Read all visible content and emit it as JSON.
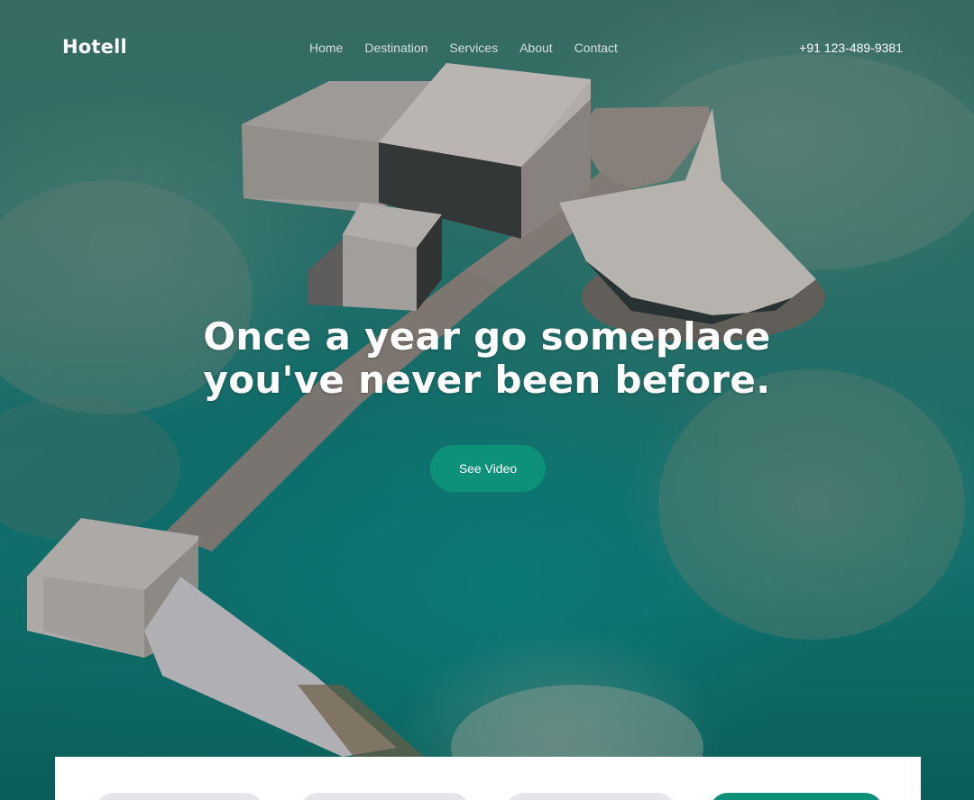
{
  "brand": {
    "name": "Hotell"
  },
  "nav": {
    "items": [
      {
        "label": "Home"
      },
      {
        "label": "Destination"
      },
      {
        "label": "Services"
      },
      {
        "label": "About"
      },
      {
        "label": "Contact"
      }
    ],
    "phone": "+91 123-489-9381"
  },
  "hero": {
    "headline_line1": "Once a year go someplace",
    "headline_line2": "you've never been before.",
    "cta_label": "See Video"
  },
  "colors": {
    "accent": "#0d9178",
    "water": "#147f7a",
    "panel": "#ffffff",
    "field": "#e6e6ea"
  }
}
